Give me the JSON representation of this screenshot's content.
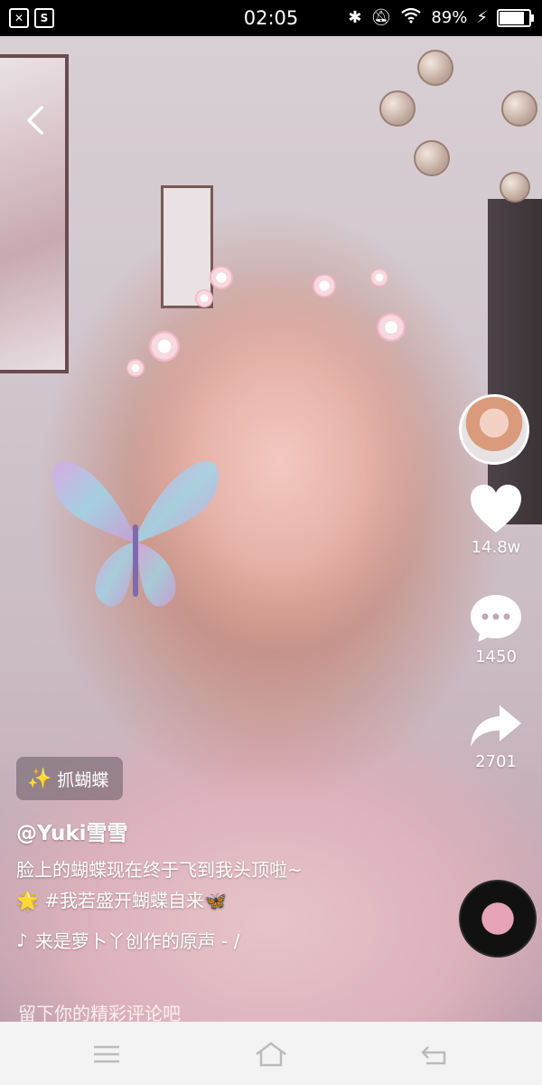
{
  "status_bar": {
    "time": "02:05",
    "battery_text": "89%",
    "battery_level": 0.89,
    "left_icons": [
      "x-notification-icon",
      "s-notification-icon"
    ],
    "right_icons": [
      "bluetooth-icon",
      "mute-icon",
      "wifi-icon",
      "charging-icon"
    ]
  },
  "video": {
    "sticker_label": "抓蝴蝶",
    "username": "@Yuki雪雪",
    "caption_line1": "脸上的蝴蝶现在终于飞到我头顶啦~",
    "caption_line2": "🌟 #我若盛开蝴蝶自来🦋",
    "music_text": "来是萝卜丫创作的原声 - /",
    "comment_placeholder": "留下你的精彩评论吧"
  },
  "actions": {
    "likes": "14.8w",
    "comments": "1450",
    "shares": "2701"
  },
  "colors": {
    "nav_background": "#f3f3f3",
    "status_background": "#000000"
  }
}
